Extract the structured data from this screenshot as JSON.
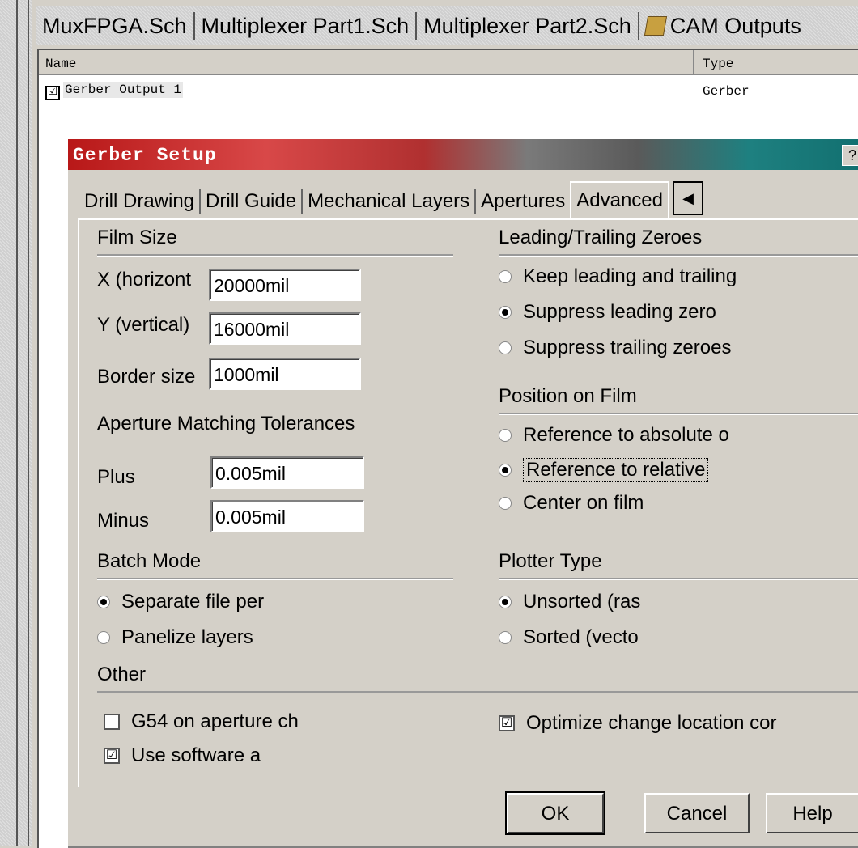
{
  "doc_tabs": [
    "MuxFPGA.Sch",
    "Multiplexer Part1.Sch",
    "Multiplexer Part2.Sch",
    "CAM Outputs"
  ],
  "cam_table": {
    "headers": {
      "name": "Name",
      "type": "Type"
    },
    "rows": [
      {
        "name": "Gerber Output 1",
        "type": "Gerber",
        "checked": "☑"
      }
    ]
  },
  "dialog": {
    "title": "Gerber Setup",
    "help_label": "?",
    "tabs": [
      "Drill Drawing",
      "Drill Guide",
      "Mechanical Layers",
      "Apertures",
      "Advanced"
    ],
    "scroll_left": "◀",
    "film_size": {
      "label": "Film Size",
      "x_label": "X (horizont",
      "x_value": "20000mil",
      "y_label": "Y (vertical)",
      "y_value": "16000mil",
      "border_label": "Border size",
      "border_value": "1000mil"
    },
    "aperture": {
      "label": "Aperture Matching Tolerances",
      "plus_label": "Plus",
      "plus_value": "0.005mil",
      "minus_label": "Minus",
      "minus_value": "0.005mil"
    },
    "batch_mode": {
      "label": "Batch Mode",
      "options": [
        "Separate file per",
        "Panelize layers"
      ],
      "selected": 0
    },
    "other": {
      "label": "Other",
      "g54": "G54 on aperture ch",
      "g54_checked": "",
      "software": "Use software a",
      "software_checked": "☑",
      "optimize": "Optimize change location cor",
      "optimize_checked": "☑"
    },
    "zeroes": {
      "label": "Leading/Trailing Zeroes",
      "options": [
        "Keep leading and trailing",
        "Suppress leading zero",
        "Suppress trailing zeroes"
      ],
      "selected": 1
    },
    "position": {
      "label": "Position on Film",
      "options": [
        "Reference to absolute o",
        "Reference to relative",
        "Center on film"
      ],
      "selected": 1
    },
    "plotter": {
      "label": "Plotter Type",
      "options": [
        "Unsorted (ras",
        "Sorted (vecto"
      ],
      "selected": 0
    },
    "buttons": {
      "ok": "OK",
      "cancel": "Cancel",
      "help": "Help"
    }
  }
}
